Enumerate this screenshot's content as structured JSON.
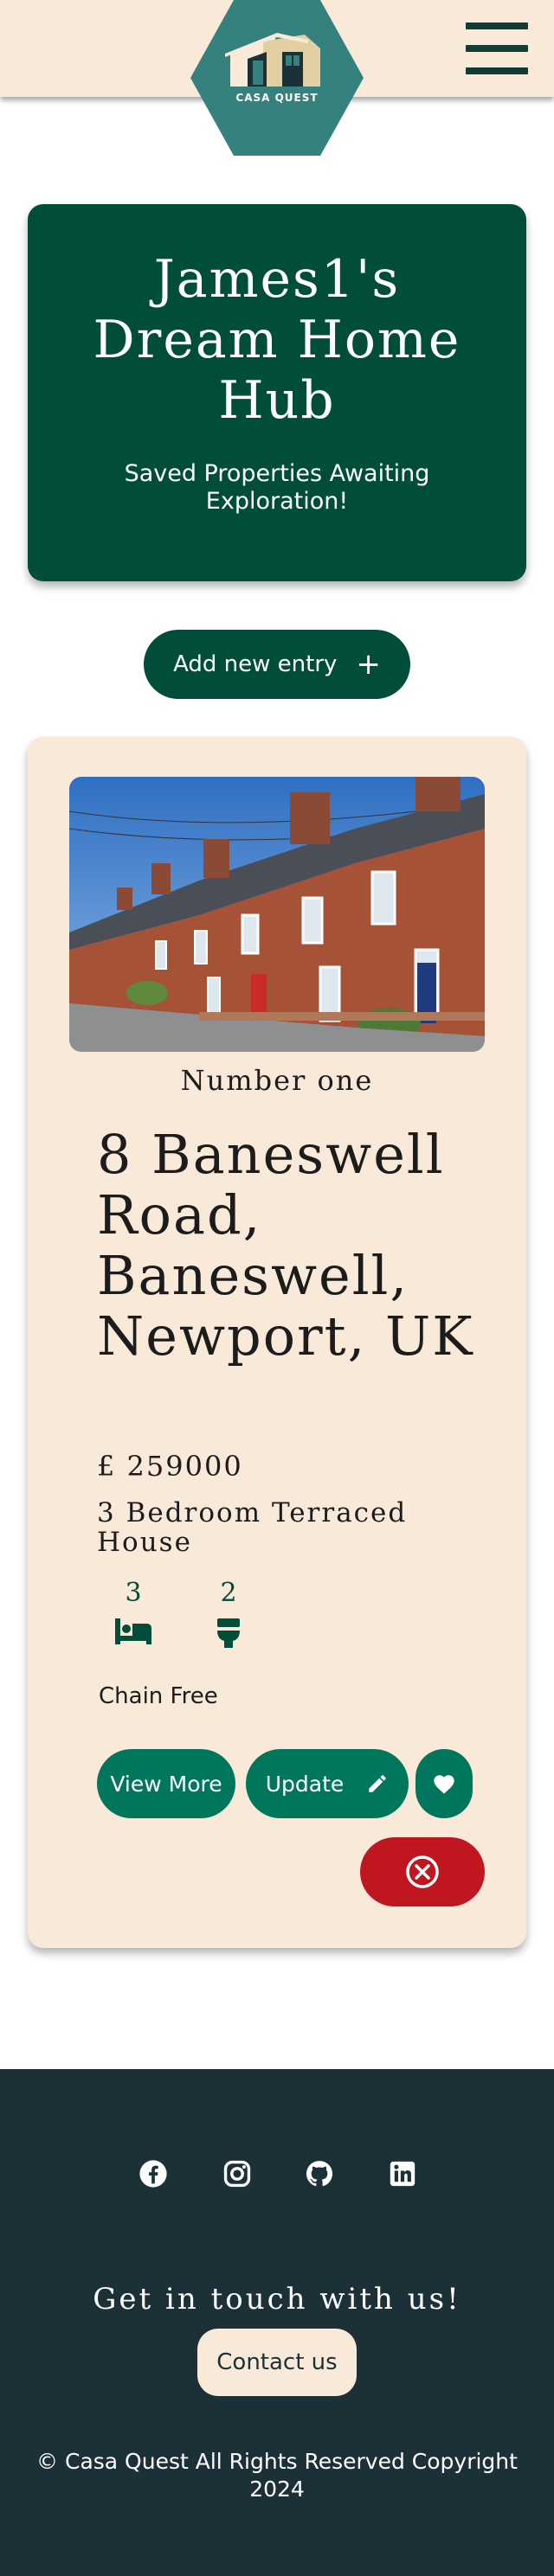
{
  "header": {
    "logo_text": "CASA QUEST",
    "menu_icon": "hamburger-menu-icon"
  },
  "hero": {
    "title": "James1's Dream Home Hub",
    "subtitle": "Saved Properties Awaiting Exploration!"
  },
  "add_entry": {
    "label": "Add new entry",
    "icon": "+"
  },
  "property": {
    "entry_name": "Number one",
    "address": "8 Baneswell Road, Baneswell, Newport, UK",
    "price": "£ 259000",
    "type": "3 Bedroom Terraced House",
    "bedrooms": "3",
    "bathrooms": "2",
    "chain_status": "Chain Free",
    "view_more_label": "View More",
    "update_label": "Update",
    "favourite_icon": "heart-icon",
    "delete_icon": "close-circle-icon"
  },
  "footer": {
    "social_icons": [
      "facebook-icon",
      "instagram-icon",
      "github-icon",
      "linkedin-icon"
    ],
    "touch_heading": "Get in touch with us!",
    "contact_label": "Contact us",
    "copyright": "© Casa Quest All Rights Reserved Copyright 2024"
  },
  "colors": {
    "header_bg": "#f8e9d9",
    "primary_dark_green": "#004d3a",
    "button_green": "#00775c",
    "delete_red": "#bf1620",
    "footer_bg": "#1b3137",
    "logo_teal": "#35817e"
  }
}
